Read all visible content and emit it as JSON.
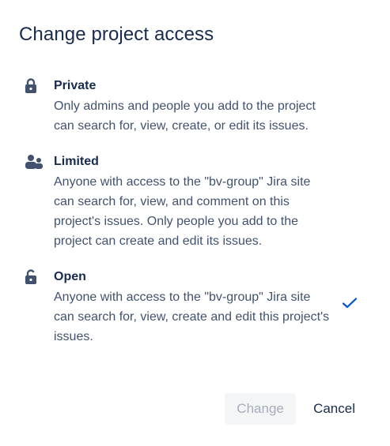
{
  "dialog": {
    "title": "Change project access",
    "options": [
      {
        "icon": "lock-icon",
        "name": "Private",
        "description": "Only admins and people you add to the project can search for, view, create, or edit its issues.",
        "selected": false
      },
      {
        "icon": "people-icon",
        "name": "Limited",
        "description": "Anyone with access to the \"bv-group\" Jira site can search for, view, and comment on this project's issues. Only people you add to the project can create and edit its issues.",
        "selected": false
      },
      {
        "icon": "unlock-icon",
        "name": "Open",
        "description": "Anyone with access to the \"bv-group\" Jira site can search for, view, create and edit this project's issues.",
        "selected": true
      }
    ],
    "buttons": {
      "change_label": "Change",
      "cancel_label": "Cancel"
    }
  },
  "colors": {
    "text_primary": "#172b4d",
    "text_secondary": "#42526e",
    "icon": "#42526e",
    "accent_check": "#0052cc",
    "disabled_button_bg": "#f4f5f7",
    "disabled_button_text": "#a5adba"
  }
}
